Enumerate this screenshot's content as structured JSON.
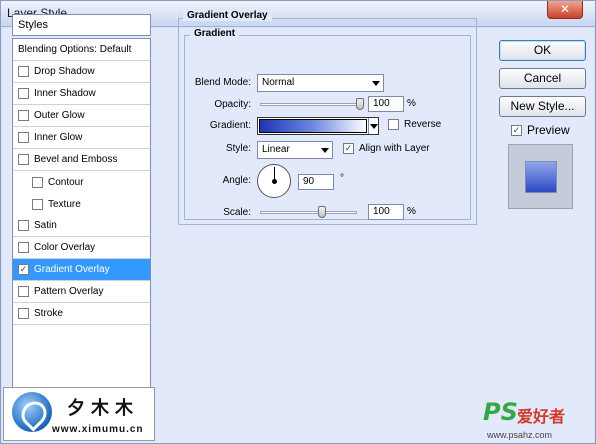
{
  "window": {
    "title": "Layer Style",
    "close_glyph": "✕"
  },
  "styles_panel": {
    "header": "Styles",
    "items": [
      {
        "label": "Blending Options: Default",
        "checkbox": false,
        "checked": false,
        "indent": false,
        "active": false
      },
      {
        "label": "Drop Shadow",
        "checkbox": true,
        "checked": false,
        "indent": false,
        "active": false
      },
      {
        "label": "Inner Shadow",
        "checkbox": true,
        "checked": false,
        "indent": false,
        "active": false
      },
      {
        "label": "Outer Glow",
        "checkbox": true,
        "checked": false,
        "indent": false,
        "active": false
      },
      {
        "label": "Inner Glow",
        "checkbox": true,
        "checked": false,
        "indent": false,
        "active": false
      },
      {
        "label": "Bevel and Emboss",
        "checkbox": true,
        "checked": false,
        "indent": false,
        "active": false
      },
      {
        "label": "Contour",
        "checkbox": true,
        "checked": false,
        "indent": true,
        "active": false
      },
      {
        "label": "Texture",
        "checkbox": true,
        "checked": false,
        "indent": true,
        "active": false
      },
      {
        "label": "Satin",
        "checkbox": true,
        "checked": false,
        "indent": false,
        "active": false
      },
      {
        "label": "Color Overlay",
        "checkbox": true,
        "checked": false,
        "indent": false,
        "active": false
      },
      {
        "label": "Gradient Overlay",
        "checkbox": true,
        "checked": true,
        "indent": false,
        "active": true
      },
      {
        "label": "Pattern Overlay",
        "checkbox": true,
        "checked": false,
        "indent": false,
        "active": false
      },
      {
        "label": "Stroke",
        "checkbox": true,
        "checked": false,
        "indent": false,
        "active": false
      }
    ]
  },
  "gradient_overlay": {
    "section_title": "Gradient Overlay",
    "group_title": "Gradient",
    "blend_mode_label": "Blend Mode:",
    "blend_mode_value": "Normal",
    "opacity_label": "Opacity:",
    "opacity_value": "100",
    "opacity_unit": "%",
    "opacity_fraction": 1.0,
    "gradient_label": "Gradient:",
    "reverse_label": "Reverse",
    "reverse_checked": false,
    "style_label": "Style:",
    "style_value": "Linear",
    "align_label": "Align with Layer",
    "align_checked": true,
    "angle_label": "Angle:",
    "angle_value": "90",
    "angle_unit": "°",
    "scale_label": "Scale:",
    "scale_value": "100",
    "scale_unit": "%",
    "scale_fraction": 0.6
  },
  "buttons": {
    "ok": "OK",
    "cancel": "Cancel",
    "new_style": "New Style..."
  },
  "preview": {
    "label": "Preview",
    "checked": true
  },
  "watermarks": {
    "left_cn": "夕木木",
    "left_url": "www.ximumu.cn",
    "right_ps": "PS",
    "right_cn": "爱好者",
    "right_url": "www.psahz.com"
  },
  "colors": {
    "selection": "#3399ff",
    "gradient_start": "#1c35b5",
    "gradient_end": "#ffffff"
  }
}
